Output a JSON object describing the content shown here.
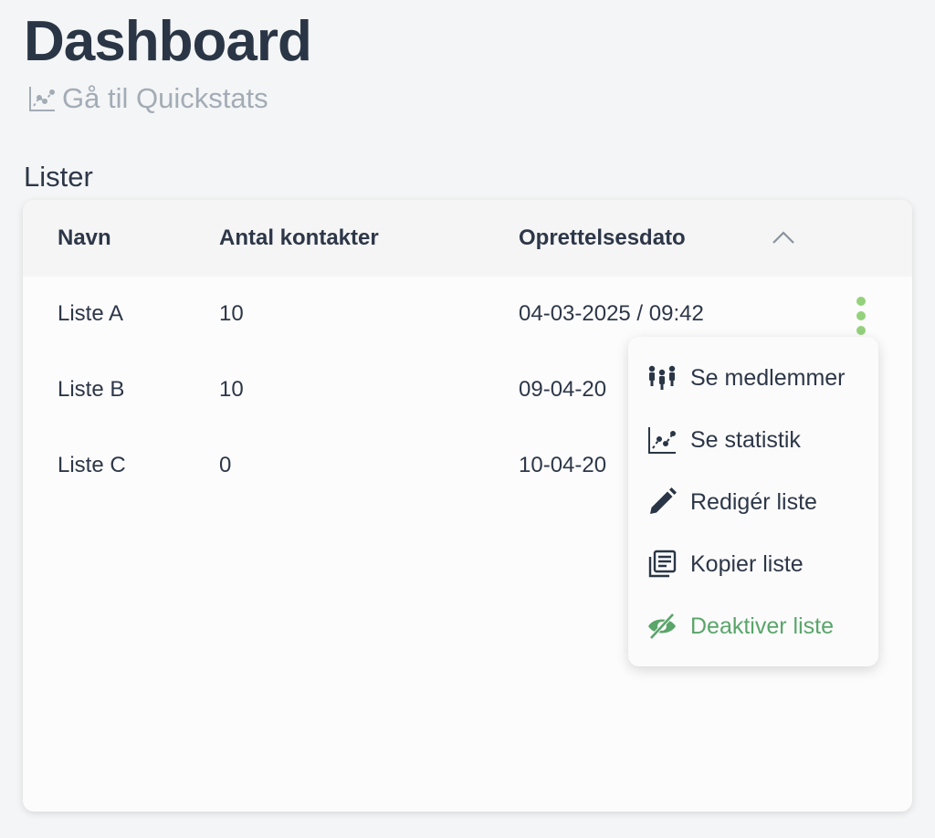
{
  "header": {
    "title": "Dashboard",
    "quickstats_link": "Gå til Quickstats"
  },
  "section": {
    "title": "Lister"
  },
  "table": {
    "columns": [
      "Navn",
      "Antal kontakter",
      "Oprettelsesdato"
    ],
    "rows": [
      {
        "name": "Liste A",
        "count": "10",
        "date": "04-03-2025 / 09:42"
      },
      {
        "name": "Liste B",
        "count": "10",
        "date": "09-04-20"
      },
      {
        "name": "Liste C",
        "count": "0",
        "date": "10-04-20"
      }
    ]
  },
  "menu": {
    "items": [
      {
        "label": "Se medlemmer",
        "icon": "members-icon"
      },
      {
        "label": "Se statistik",
        "icon": "chart-icon"
      },
      {
        "label": "Redigér liste",
        "icon": "pencil-icon"
      },
      {
        "label": "Kopier liste",
        "icon": "copy-icon"
      },
      {
        "label": "Deaktiver liste",
        "icon": "eye-slash-icon"
      }
    ]
  },
  "colors": {
    "accent_green": "#5aa56a",
    "kebab_green": "#94d17c",
    "muted_text": "#a3acb6"
  }
}
